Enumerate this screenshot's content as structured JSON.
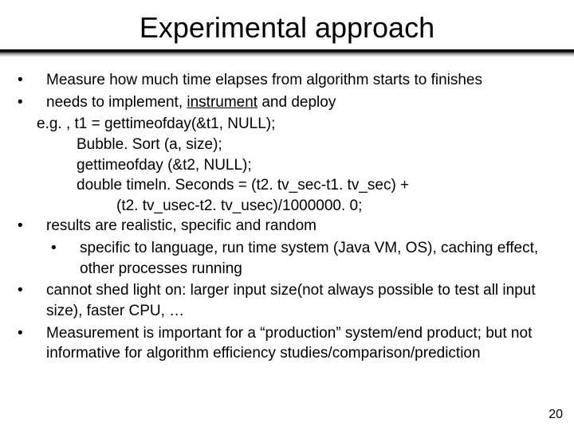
{
  "title": "Experimental approach",
  "bullets": {
    "b1": "Measure how much time elapses from algorithm starts to finishes",
    "b2_pre": "needs to implement, ",
    "b2_u": "instrument",
    "b2_post": " and deploy",
    "eg": "e.g. , t1 = gettimeofday(&t1, NULL);",
    "code1": "Bubble. Sort (a, size);",
    "code2": "gettimeofday (&t2, NULL);",
    "code3": "double timeln. Seconds = (t2. tv_sec-t1. tv_sec) +",
    "code4": "(t2. tv_usec-t2. tv_usec)/1000000. 0;",
    "b3": "results are realistic, specific and random",
    "b3a": "specific to language, run time system (Java VM, OS), caching effect, other processes running",
    "b4": "cannot shed light on: larger input size(not always possible to test all input size), faster CPU, …",
    "b5": "Measurement is important for a “production” system/end product; but not informative for algorithm efficiency studies/comparison/prediction"
  },
  "page_number": "20"
}
